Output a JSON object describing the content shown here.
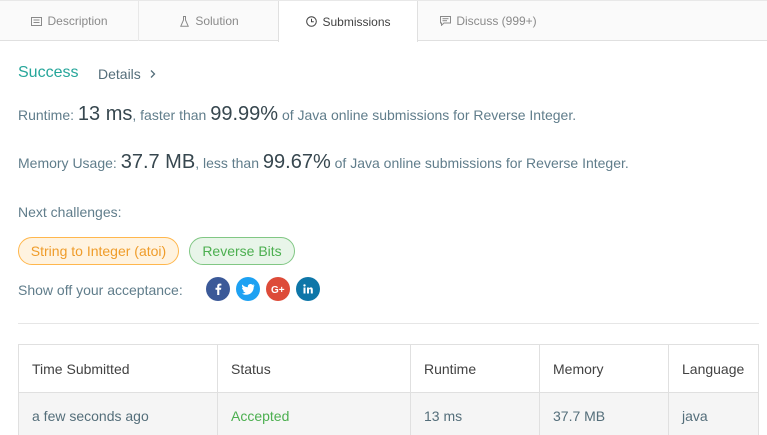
{
  "tabs": [
    {
      "label": "Description",
      "icon": "description-icon"
    },
    {
      "label": "Solution",
      "icon": "flask-icon"
    },
    {
      "label": "Submissions",
      "icon": "clock-icon"
    },
    {
      "label": "Discuss (999+)",
      "icon": "comment-icon"
    }
  ],
  "active_tab": "Submissions",
  "result": {
    "status": "Success",
    "details_label": "Details",
    "runtime_label": "Runtime: ",
    "runtime_value": "13 ms",
    "runtime_mid": ", faster than ",
    "runtime_pct": "99.99%",
    "runtime_tail": " of Java online submissions for Reverse Integer.",
    "memory_label": "Memory Usage: ",
    "memory_value": "37.7 MB",
    "memory_mid": ", less than ",
    "memory_pct": "99.67%",
    "memory_tail": " of Java online submissions for Reverse Integer."
  },
  "next_challenges": {
    "label": "Next challenges:",
    "items": [
      "String to Integer (atoi)",
      "Reverse Bits"
    ]
  },
  "share": {
    "label": "Show off your acceptance:",
    "networks": [
      "facebook-icon",
      "twitter-icon",
      "google-plus-icon",
      "linkedin-icon"
    ]
  },
  "table": {
    "headers": [
      "Time Submitted",
      "Status",
      "Runtime",
      "Memory",
      "Language"
    ],
    "rows": [
      [
        "a few seconds ago",
        "Accepted",
        "13 ms",
        "37.7 MB",
        "java"
      ]
    ]
  },
  "colors": {
    "success": "#26a69a",
    "accepted": "#4caf50",
    "chip_orange": "#ef9c2a",
    "chip_green": "#4caf50"
  }
}
